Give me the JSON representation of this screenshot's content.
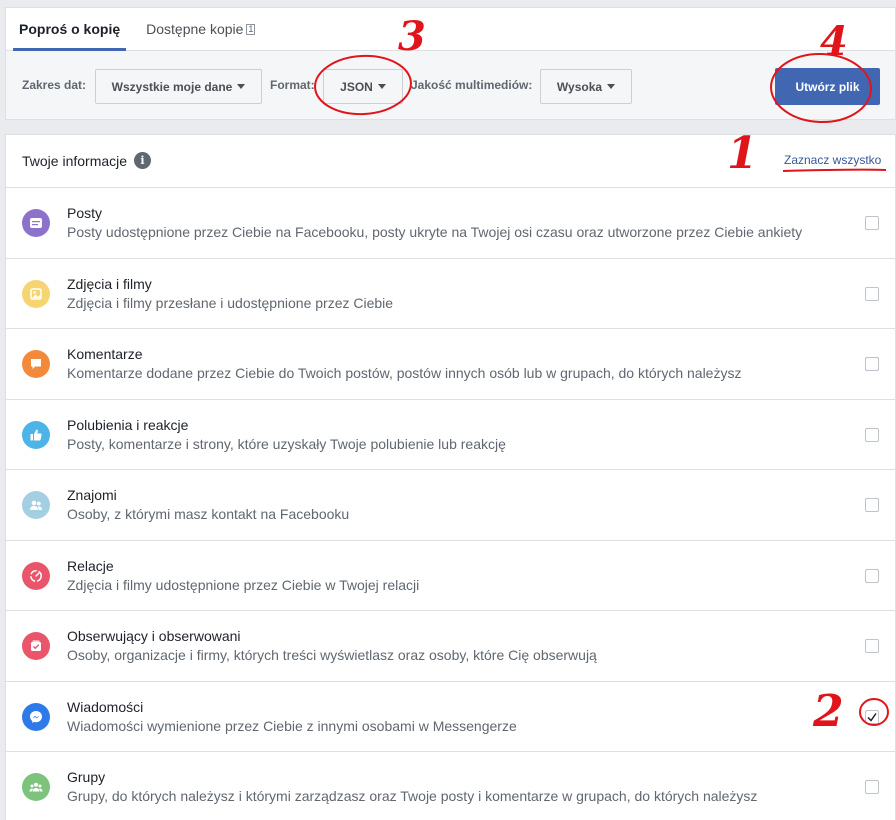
{
  "tabs": [
    {
      "label": "Poproś o kopię",
      "active": true
    },
    {
      "label": "Dostępne kopie",
      "count": "1",
      "active": false
    }
  ],
  "filters": {
    "date_label": "Zakres dat:",
    "date_value": "Wszystkie moje dane",
    "format_label": "Format:",
    "format_value": "JSON",
    "quality_label": "Jakość multimediów:",
    "quality_value": "Wysoka",
    "create_label": "Utwórz plik"
  },
  "list": {
    "title": "Twoje informacje",
    "select_all": "Zaznacz wszystko",
    "items": [
      {
        "title": "Posty",
        "desc": "Posty udostępnione przez Ciebie na Facebooku, posty ukryte na Twojej osi czasu oraz utworzone przez Ciebie ankiety",
        "color": "#8c72cb",
        "icon": "posts-icon",
        "checked": false
      },
      {
        "title": "Zdjęcia i filmy",
        "desc": "Zdjęcia i filmy przesłane i udostępnione przez Ciebie",
        "color": "#f7d472",
        "icon": "photos-icon",
        "checked": false
      },
      {
        "title": "Komentarze",
        "desc": "Komentarze dodane przez Ciebie do Twoich postów, postów innych osób lub w grupach, do których należysz",
        "color": "#f3893a",
        "icon": "comment-icon",
        "checked": false
      },
      {
        "title": "Polubienia i reakcje",
        "desc": "Posty, komentarze i strony, które uzyskały Twoje polubienie lub reakcję",
        "color": "#4cb4e7",
        "icon": "like-icon",
        "checked": false
      },
      {
        "title": "Znajomi",
        "desc": "Osoby, z którymi masz kontakt na Facebooku",
        "color": "#a4cfe3",
        "icon": "friends-icon",
        "checked": false
      },
      {
        "title": "Relacje",
        "desc": "Zdjęcia i filmy udostępnione przez Ciebie w Twojej relacji",
        "color": "#e9556b",
        "icon": "stories-icon",
        "checked": false
      },
      {
        "title": "Obserwujący i obserwowani",
        "desc": "Osoby, organizacje i firmy, których treści wyświetlasz oraz osoby, które Cię obserwują",
        "color": "#e9556b",
        "icon": "followers-icon",
        "checked": false
      },
      {
        "title": "Wiadomości",
        "desc": "Wiadomości wymienione przez Ciebie z innymi osobami w Messengerze",
        "color": "#2d7ae8",
        "icon": "messenger-icon",
        "checked": true
      },
      {
        "title": "Grupy",
        "desc": "Grupy, do których należysz i którymi zarządzasz oraz Twoje posty i komentarze w grupach, do których należysz",
        "color": "#7dc37c",
        "icon": "groups-icon",
        "checked": false
      }
    ]
  },
  "annotations": [
    "1",
    "2",
    "3",
    "4"
  ],
  "colors": {
    "accent": "#4267b2",
    "link": "#365899",
    "annotation": "#e0151b"
  }
}
